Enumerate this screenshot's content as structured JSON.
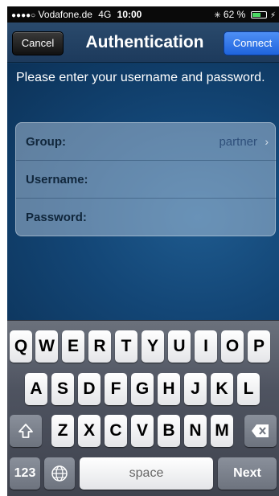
{
  "status_bar": {
    "signal_dots": "●●●●○",
    "carrier": "Vodafone.de",
    "network": "4G",
    "time": "10:00",
    "activity_icon": "loading-icon",
    "battery": "62 %",
    "battery_level": 0.62,
    "charge_icon": "charging-bolt-icon"
  },
  "nav": {
    "cancel": "Cancel",
    "title": "Authentication",
    "connect": "Connect"
  },
  "prompt": "Please enter your username and password.",
  "form": {
    "group_label": "Group:",
    "group_value": "partner",
    "username_label": "Username:",
    "username_value": "",
    "password_label": "Password:",
    "password_value": ""
  },
  "keyboard": {
    "row1": [
      "Q",
      "W",
      "E",
      "R",
      "T",
      "Y",
      "U",
      "I",
      "O",
      "P"
    ],
    "row2": [
      "A",
      "S",
      "D",
      "F",
      "G",
      "H",
      "J",
      "K",
      "L"
    ],
    "row3": [
      "Z",
      "X",
      "C",
      "V",
      "B",
      "N",
      "M"
    ],
    "shift_icon": "shift-arrow-icon",
    "delete_icon": "delete-backspace-icon",
    "globe_icon": "globe-icon",
    "numbers": "123",
    "space": "space",
    "next": "Next"
  },
  "colors": {
    "nav_bar": "#1d3a5c",
    "connect_button": "#2f7bf0",
    "background": "#134676"
  }
}
